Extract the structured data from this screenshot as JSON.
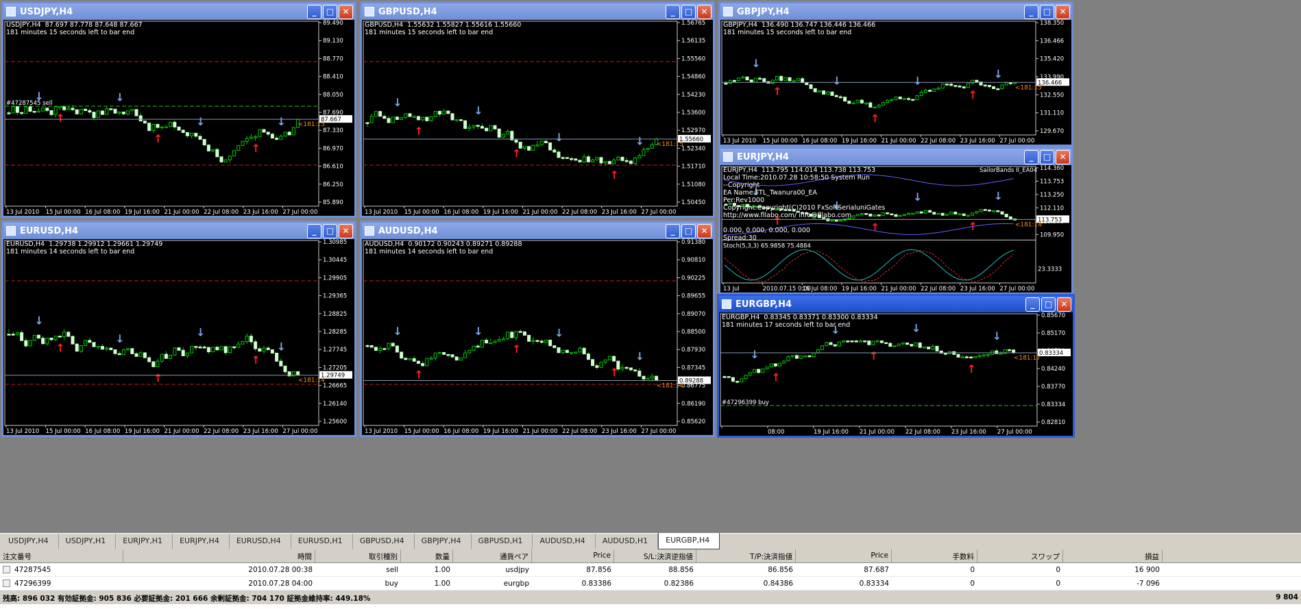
{
  "windows": [
    {
      "title": "USDJPY,H4",
      "info": "USDJPY,H4  87.697 87.778 87.648 87.667\n181 minutes 15 seconds left to bar end",
      "prices": [
        "89.490",
        "89.130",
        "88.770",
        "88.410",
        "88.050",
        "87.690",
        "87.330",
        "86.970",
        "86.610",
        "86.250",
        "85.890"
      ],
      "price_label": "87.667",
      "dates": [
        "13 Jul 2010",
        "15 Jul 00:00",
        "16 Jul 08:00",
        "19 Jul 16:00",
        "21 Jul 00:00",
        "22 Jul 08:00",
        "23 Jul 16:00",
        "27 Jul 00:00"
      ],
      "timer": "<181:15",
      "order": "#47287545 sell"
    },
    {
      "title": "GBPUSD,H4",
      "info": "GBPUSD,H4  1.55632 1.55827 1.55616 1.55660\n181 minutes 15 seconds left to bar end",
      "prices": [
        "1.56765",
        "1.56135",
        "1.55560",
        "1.54860",
        "1.54230",
        "1.53600",
        "1.52970",
        "1.52340",
        "1.51710",
        "1.51080",
        "1.50450"
      ],
      "price_label": "1.55660",
      "dates": [
        "13 Jul 2010",
        "15 Jul 00:00",
        "16 Jul 08:00",
        "19 Jul 16:00",
        "21 Jul 00:00",
        "22 Jul 08:00",
        "23 Jul 16:00",
        "27 Jul 00:00"
      ],
      "timer": "<181:15"
    },
    {
      "title": "GBPJPY,H4",
      "info": "GBPJPY,H4  136.490 136.747 136.446 136.466\n181 minutes 15 seconds left to bar end",
      "prices": [
        "138.350",
        "136.466",
        "135.420",
        "133.990",
        "132.550",
        "131.110",
        "129.670"
      ],
      "price_label": "136.466",
      "dates": [
        "13 Jul 2010",
        "15 Jul 00:00",
        "16 Jul 08:00",
        "19 Jul 16:00",
        "21 Jul 00:00",
        "22 Jul 08:00",
        "23 Jul 16:00",
        "27 Jul 00:00"
      ],
      "timer": "<181:15"
    },
    {
      "title": "EURJPY,H4",
      "info": "EURJPY,H4  113.795 114.014 113.738 113.753\nLocal Time:2010.07.28 10:58:50 System Run\n--Copyright\nEA Name:FTL_Twanura00_EA\nPer:Rev1000\nCopyright:Copyright(C)2010 FxSoftSerialuniGates\nhttp://www.fllabo.com/ info@fllabo.com\n\n0.000, 0.000, 0.000, 0.000\nSpread:30",
      "prices": [
        "114.360",
        "113.753",
        "113.250",
        "112.110",
        "110.970",
        "109.950"
      ],
      "price_label": "113.753",
      "stoch": "Stoch(5,3,3) 65.9858 75.4884",
      "stoch_prices": [
        "23.3333"
      ],
      "dates": [
        "13 Jul",
        "2010.07.15 0:00",
        "16 Jul 08:00",
        "19 Jul 16:00",
        "21 Jul 00:00",
        "22 Jul 08:00",
        "23 Jul 16:00",
        "27 Jul 00:00"
      ],
      "timer": "<181:14",
      "ea_label": "SailorBands II_EA04"
    },
    {
      "title": "EURUSD,H4",
      "info": "EURUSD,H4  1.29738 1.29912 1.29661 1.29749\n181 minutes 14 seconds left to bar end",
      "prices": [
        "1.30985",
        "1.30445",
        "1.29905",
        "1.29365",
        "1.28825",
        "1.28285",
        "1.27745",
        "1.27205",
        "1.26665",
        "1.26140",
        "1.25600"
      ],
      "price_label": "1.29749",
      "dates": [
        "13 Jul 2010",
        "15 Jul 00:00",
        "16 Jul 08:00",
        "19 Jul 16:00",
        "21 Jul 00:00",
        "22 Jul 08:00",
        "23 Jul 16:00",
        "27 Jul 00:00"
      ],
      "timer": "<181:14"
    },
    {
      "title": "AUDUSD,H4",
      "info": "AUDUSD,H4  0.90172 0.90243 0.89271 0.89288\n181 minutes 14 seconds left to bar end",
      "prices": [
        "0.91380",
        "0.90810",
        "0.90225",
        "0.89655",
        "0.89070",
        "0.88500",
        "0.87930",
        "0.87345",
        "0.86775",
        "0.86190",
        "0.85620"
      ],
      "price_label": "0.89288",
      "dates": [
        "13 Jul 2010",
        "15 Jul 00:00",
        "16 Jul 08:00",
        "19 Jul 16:00",
        "21 Jul 00:00",
        "22 Jul 08:00",
        "23 Jul 16:00",
        "27 Jul 00:00"
      ],
      "timer": "<181:14"
    },
    {
      "title": "EURGBP,H4",
      "info": "EURGBP,H4  0.83345 0.83371 0.83300 0.83334\n181 minutes 17 seconds left to bar end",
      "prices": [
        "0.85670",
        "0.85170",
        "0.84710",
        "0.84240",
        "0.83770",
        "0.83334",
        "0.82810"
      ],
      "price_label": "0.83334",
      "dates": [
        "",
        "08:00",
        "19 Jul 16:00",
        "21 Jul 00:00",
        "22 Jul 08:00",
        "23 Jul 16:00",
        "27 Jul 00:00"
      ],
      "timer": "<181:17",
      "order": "#47296399 buy"
    }
  ],
  "tabs": [
    "USDJPY,H4",
    "USDJPY,H1",
    "EURJPY,H1",
    "EURJPY,H4",
    "EURUSD,H4",
    "EURUSD,H1",
    "GBPUSD,H4",
    "GBPJPY,H4",
    "GBPUSD,H1",
    "AUDUSD,H4",
    "AUDUSD,H1",
    "EURGBP,H4"
  ],
  "active_tab": "EURGBP,H4",
  "terminal": {
    "headers": [
      "注文番号",
      "時間",
      "取引種別",
      "数量",
      "通貨ペア",
      "Price",
      "S/L:決済逆指値",
      "T/P:決済指値",
      "Price",
      "手数料",
      "スワップ",
      "損益"
    ],
    "rows": [
      [
        "47287545",
        "2010.07.28 00:38",
        "sell",
        "1.00",
        "usdjpy",
        "87.856",
        "88.856",
        "86.856",
        "87.687",
        "0",
        "0",
        "16 900"
      ],
      [
        "47296399",
        "2010.07.28 04:00",
        "buy",
        "1.00",
        "eurgbp",
        "0.83386",
        "0.82386",
        "0.84386",
        "0.83334",
        "0",
        "0",
        "-7 096"
      ]
    ],
    "total": "残高: 896 032  有効証拠金: 905 836  必要証拠金: 201 666  余剰証拠金: 704 170  証拠金維持率: 449.18%",
    "total_pl": "9 804"
  },
  "colors": {
    "bull": "#ccffcc",
    "bear": "#00cc00",
    "buy_arrow": "#ff2020",
    "sell_arrow": "#7ba7e8",
    "timer": "#ff8c1a"
  }
}
